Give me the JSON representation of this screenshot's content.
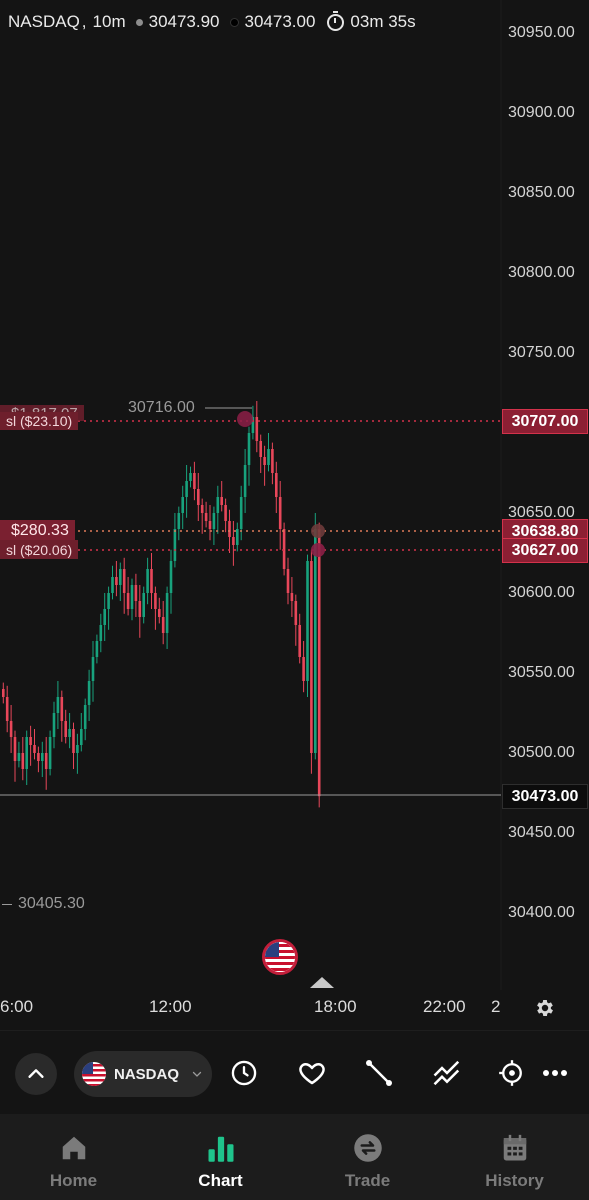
{
  "header": {
    "symbol": "NASDAQ",
    "separator": ",",
    "interval": "10m",
    "bid": "30473.90",
    "ask": "30473.00",
    "countdown": "03m 35s"
  },
  "price_axis": {
    "labels": [
      "30950.00",
      "30900.00",
      "30850.00",
      "30800.00",
      "30750.00",
      "30650.00",
      "30600.00",
      "30550.00",
      "30500.00",
      "30450.00",
      "30400.00"
    ],
    "tags": {
      "tp_price": "30707.00",
      "entry_price": "30638.80",
      "sl_price": "30627.00",
      "current_price": "30473.00"
    }
  },
  "chart_overlay": {
    "high_marker": "30716.00",
    "low_marker": "30405.30",
    "position_1_profit": "$1,817.07",
    "position_1_sl": "sl ($23.10)",
    "position_2_profit": "$280.33",
    "position_2_sl": "sl ($20.06)"
  },
  "time_axis": {
    "labels": [
      "6:00",
      "12:00",
      "18:00",
      "22:00",
      "2"
    ]
  },
  "toolbar": {
    "symbol_name": "NASDAQ",
    "tools": [
      "chevron-up-icon",
      "clock-icon",
      "heart-icon",
      "trend-line-icon",
      "parallel-channel-icon",
      "target-icon",
      "more-icon"
    ]
  },
  "nav": {
    "items": [
      {
        "label": "Home",
        "icon": "home-icon",
        "active": false
      },
      {
        "label": "Chart",
        "icon": "chart-icon",
        "active": true
      },
      {
        "label": "Trade",
        "icon": "trade-icon",
        "active": false
      },
      {
        "label": "History",
        "icon": "calendar-icon",
        "active": false
      }
    ]
  },
  "colors": {
    "bull": "#18a27d",
    "bear": "#e8475a",
    "accent_active": "#1fc48c",
    "tag_red": "#8c1f33"
  },
  "chart_data": {
    "type": "candlestick",
    "y_range": [
      30375,
      30960
    ],
    "y_scale": "linear",
    "x_labels": [
      "6:00",
      "12:00",
      "18:00",
      "22:00",
      "2"
    ],
    "grid": false,
    "high": 30716.0,
    "low": 30405.3,
    "current": 30473.0,
    "closes": [
      30535,
      30520,
      30510,
      30495,
      30500,
      30490,
      30510,
      30505,
      30500,
      30495,
      30500,
      30490,
      30510,
      30525,
      30535,
      30520,
      30510,
      30515,
      30500,
      30505,
      30515,
      30530,
      30545,
      30560,
      30570,
      30580,
      30590,
      30600,
      30610,
      30605,
      30615,
      30600,
      30590,
      30605,
      30595,
      30585,
      30600,
      30615,
      30600,
      30590,
      30585,
      30575,
      30600,
      30620,
      30640,
      30650,
      30660,
      30670,
      30675,
      30665,
      30655,
      30650,
      30645,
      30640,
      30650,
      30660,
      30655,
      30645,
      30635,
      30630,
      30640,
      30660,
      30680,
      30700,
      30710,
      30695,
      30685,
      30680,
      30690,
      30675,
      30660,
      30640,
      30615,
      30600,
      30595,
      30580,
      30560,
      30545,
      30620,
      30500,
      30640,
      30473
    ]
  }
}
